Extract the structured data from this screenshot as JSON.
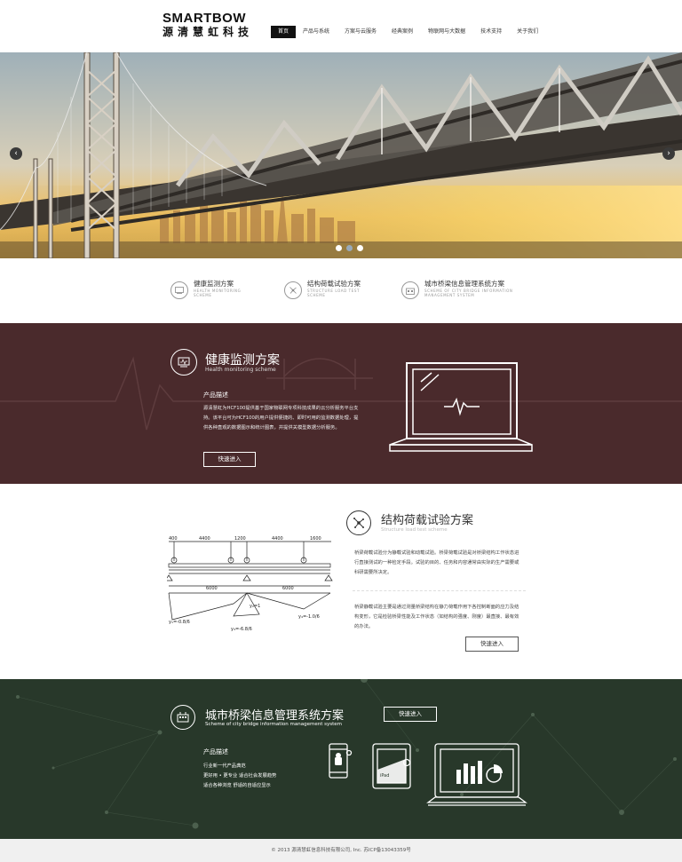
{
  "header": {
    "logo_en": "SMARTBOW",
    "logo_cn": "源清慧虹科技",
    "nav": [
      {
        "label": "首页",
        "active": true
      },
      {
        "label": "产品与系统"
      },
      {
        "label": "方案与云服务"
      },
      {
        "label": "经典案例"
      },
      {
        "label": "物联网与大数据"
      },
      {
        "label": "技术支持"
      },
      {
        "label": "关于我们"
      }
    ]
  },
  "banner": {
    "arrow_left": "‹",
    "arrow_right": "›",
    "slides": 3,
    "active_slide": 3
  },
  "quick_links": [
    {
      "title": "健康监测方案",
      "subtitle": "HEALTH MONITORING SCHEME",
      "icon": "monitor-icon"
    },
    {
      "title": "结构荷载试验方案",
      "subtitle": "STRUCTURE LOAD TEST SCHEME",
      "icon": "network-icon"
    },
    {
      "title": "城市桥梁信息管理系统方案",
      "subtitle": "SCHEME OF CITY BRIDGE INFORMATION MANAGEMENT SYSTEM",
      "icon": "building-icon"
    }
  ],
  "health": {
    "title": "健康监测方案",
    "subtitle": "Health monitoring scheme",
    "label": "产品描述",
    "desc": "源清慧虹为HCF100提供基于国家物联网专项科技成果的云分析服务平台支持。该平台可为HCF100的用户提供便捷的、即时可用的监测数据处理，提供各种直观的数据图示和统计图表，并提供关模型数据分析服务。",
    "button": "快速进入"
  },
  "structure": {
    "title": "结构荷载试验方案",
    "subtitle": "Structure load test scheme",
    "desc1": "桥梁荷载试验分为静载试验和动载试验。桥梁荷载试验是对桥梁结构工作状态进行直接测试的一种检定手段。试验的目的、任务和内容通常由实际的生产需要或科研需要所决定。",
    "desc2": "桥梁静载试验主要是通过测量桥梁结构在静力荷载作用下各控制断面的应力及结构变形，它是检验桥梁性能及工作状态（如结构的强度、刚度）最直接、最有效的办法。",
    "button": "快速进入",
    "diagram": {
      "top_dims": [
        "400",
        "4400",
        "1200",
        "4400",
        "1600"
      ],
      "span_dims": [
        "6000",
        "6000"
      ],
      "labels": [
        "y₁=-0.8/6",
        "y₂=1",
        "y₃=-6.8/6",
        "y₄=-1.0/6"
      ]
    }
  },
  "city": {
    "title": "城市桥梁信息管理系统方案",
    "subtitle": "Scheme of city bridge information management system",
    "button": "快速进入",
    "label": "产品描述",
    "lines": [
      "行业新一代产品典范",
      "更好用 • 更专业  适合社会发展趋势",
      "适合各种浏览  舒适的自适应显示"
    ],
    "ipad_label": "iPad"
  },
  "footer": {
    "text": "© 2013 源清慧虹信息科技有限公司, Inc. 苏ICP备13043359号"
  }
}
